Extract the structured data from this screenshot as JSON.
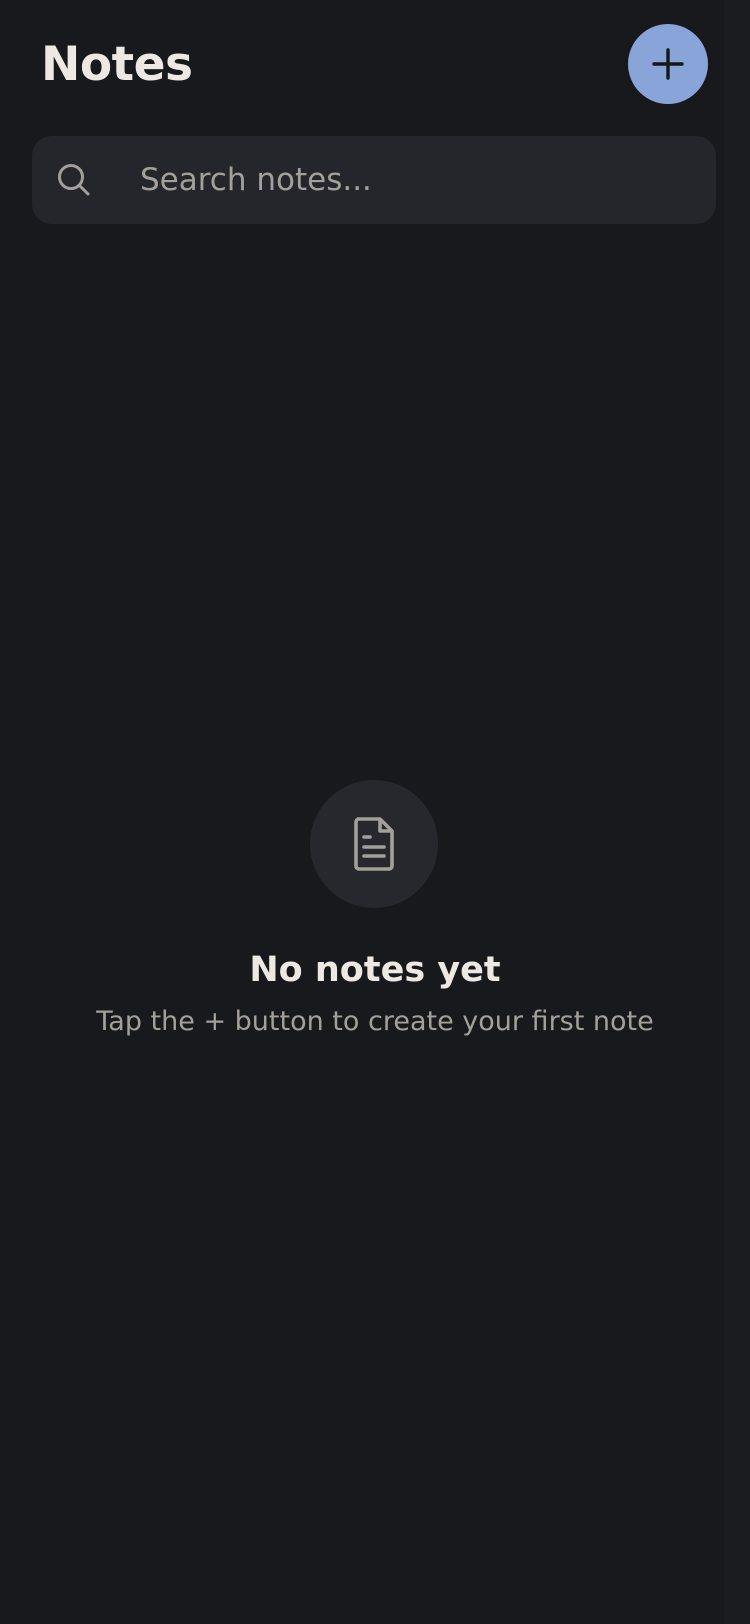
{
  "header": {
    "title": "Notes",
    "add_button_icon": "plus-icon"
  },
  "search": {
    "placeholder": "Search notes...",
    "value": "",
    "icon": "search-icon"
  },
  "empty_state": {
    "icon": "document-icon",
    "title": "No notes yet",
    "subtitle": "Tap the + button to create your first note"
  },
  "colors": {
    "background": "#18191d",
    "accent": "#88a4d8",
    "surface": "#25262b",
    "text_primary": "#ede9e2",
    "text_secondary": "#a3a099"
  }
}
